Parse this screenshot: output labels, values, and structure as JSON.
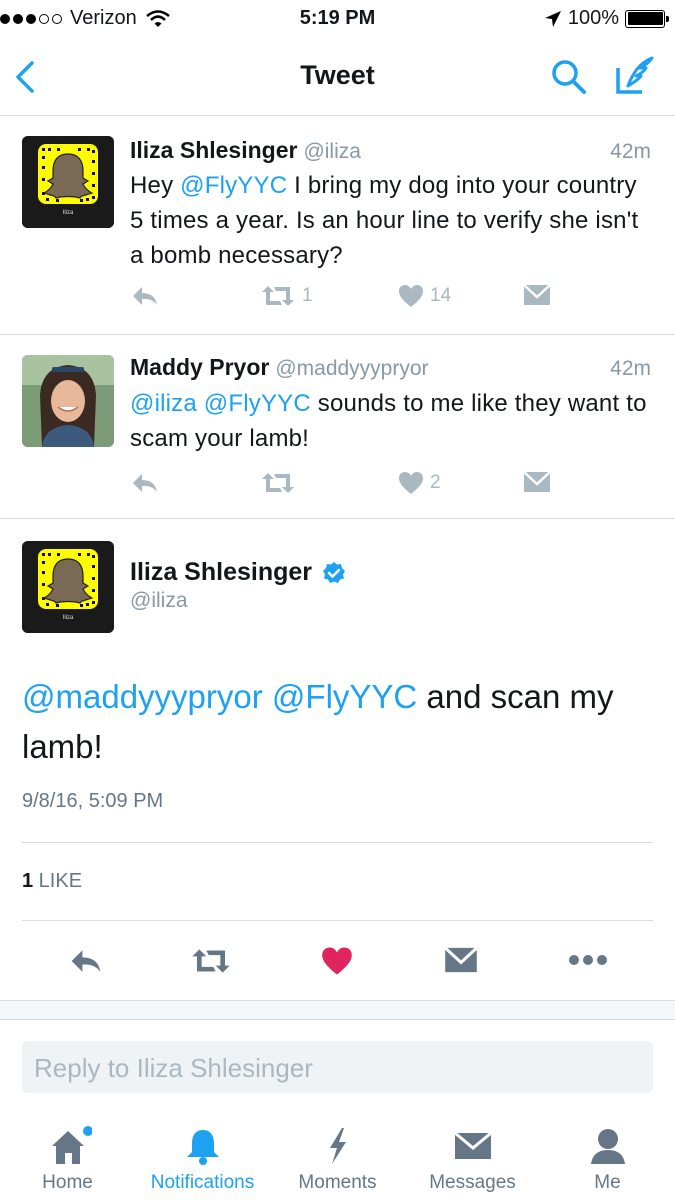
{
  "status_bar": {
    "carrier": "Verizon",
    "time": "5:19 PM",
    "battery": "100%"
  },
  "nav": {
    "title": "Tweet"
  },
  "tweets": [
    {
      "name": "Iliza Shlesinger",
      "handle": "@iliza",
      "time": "42m",
      "text_parts": [
        "Hey ",
        "@FlyYYC",
        " I bring my dog into your country 5 times a year. Is an hour line to verify she isn't a bomb necessary?"
      ],
      "retweets": "1",
      "likes": "14"
    },
    {
      "name": "Maddy Pryor",
      "handle": "@maddyyypryor",
      "time": "42m",
      "text_parts": [
        "@iliza",
        " ",
        "@FlyYYC",
        " sounds to me like they want to scam your lamb!"
      ],
      "retweets": "",
      "likes": "2"
    }
  ],
  "focused": {
    "name": "Iliza Shlesinger",
    "handle": "@iliza",
    "text_parts": [
      "@maddyyypryor",
      " ",
      "@FlyYYC",
      " and scan my lamb!"
    ],
    "date": "9/8/16, 5:09 PM",
    "like_count": "1",
    "like_label": " LIKE"
  },
  "reply": {
    "placeholder": "Reply to Iliza Shlesinger"
  },
  "tabs": [
    {
      "label": "Home"
    },
    {
      "label": "Notifications"
    },
    {
      "label": "Moments"
    },
    {
      "label": "Messages"
    },
    {
      "label": "Me"
    }
  ],
  "colors": {
    "accent": "#1da1f2",
    "like": "#e0245e",
    "muted": "#aab8c2"
  },
  "avatar_label": "Iliza"
}
